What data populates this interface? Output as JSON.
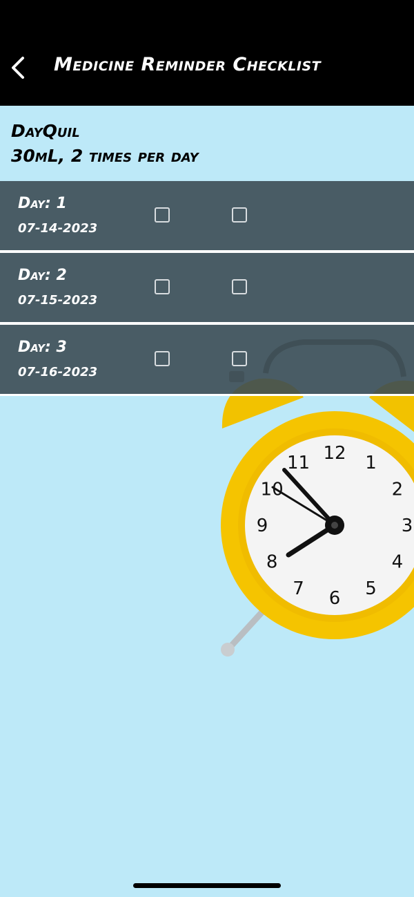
{
  "header": {
    "title": "Medicine Reminder Checklist",
    "back_icon": "chevron-left-icon"
  },
  "medicine": {
    "name": "DayQuil",
    "dosage": "30mL, 2 times per day"
  },
  "days": [
    {
      "day_label": "Day: 1",
      "date": "07-14-2023",
      "dose1_checked": false,
      "dose2_checked": false
    },
    {
      "day_label": "Day: 2",
      "date": "07-15-2023",
      "dose1_checked": false,
      "dose2_checked": false
    },
    {
      "day_label": "Day: 3",
      "date": "07-16-2023",
      "dose1_checked": false,
      "dose2_checked": false
    }
  ],
  "clock": {
    "numerals": [
      "12",
      "1",
      "2",
      "3",
      "4",
      "5",
      "6",
      "7",
      "8",
      "9",
      "10",
      "11"
    ],
    "colors": {
      "body": "#f5c400",
      "face": "#f4f4f4",
      "hands": "#111111"
    }
  },
  "colors": {
    "header_bg": "#000000",
    "page_bg": "#bde9f8",
    "row_bg": "#3c4c54"
  }
}
